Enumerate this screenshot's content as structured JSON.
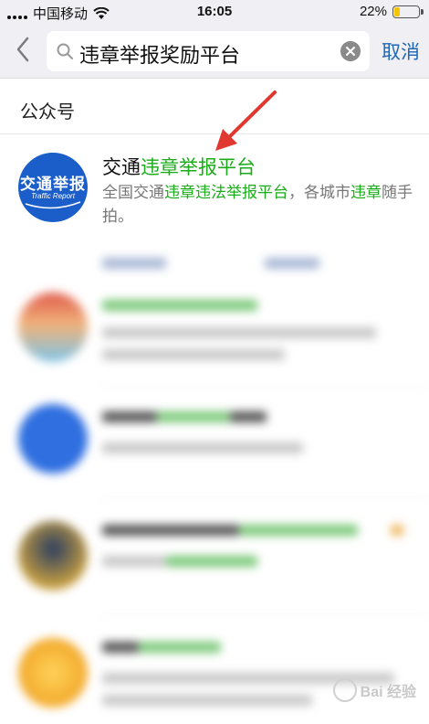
{
  "status_bar": {
    "carrier": "中国移动",
    "time": "16:05",
    "battery_percent": "22%",
    "battery_level": 0.22,
    "battery_color": "#f5c400"
  },
  "search": {
    "query": "违章举报奖励平台",
    "cancel_label": "取消",
    "icons": [
      "back-chevron-icon",
      "search-icon",
      "clear-icon"
    ]
  },
  "section": {
    "title": "公众号"
  },
  "results": [
    {
      "name_prefix": "交通",
      "name_highlight": "违章举报平台",
      "avatar_title": "交通举报",
      "avatar_subtitle": "Traffic Report",
      "avatar_color": "#1b5ec9",
      "desc_part1": "全国交通",
      "desc_hl1": "违章违法举报平台",
      "desc_part2": "，各城市",
      "desc_hl2": "违章",
      "desc_part3": "随手拍。"
    }
  ],
  "colors": {
    "highlight": "#1aad19",
    "cancel": "#1f67b3",
    "annotation_arrow": "#e0372f"
  },
  "watermark": {
    "text": "Bai 经验"
  }
}
